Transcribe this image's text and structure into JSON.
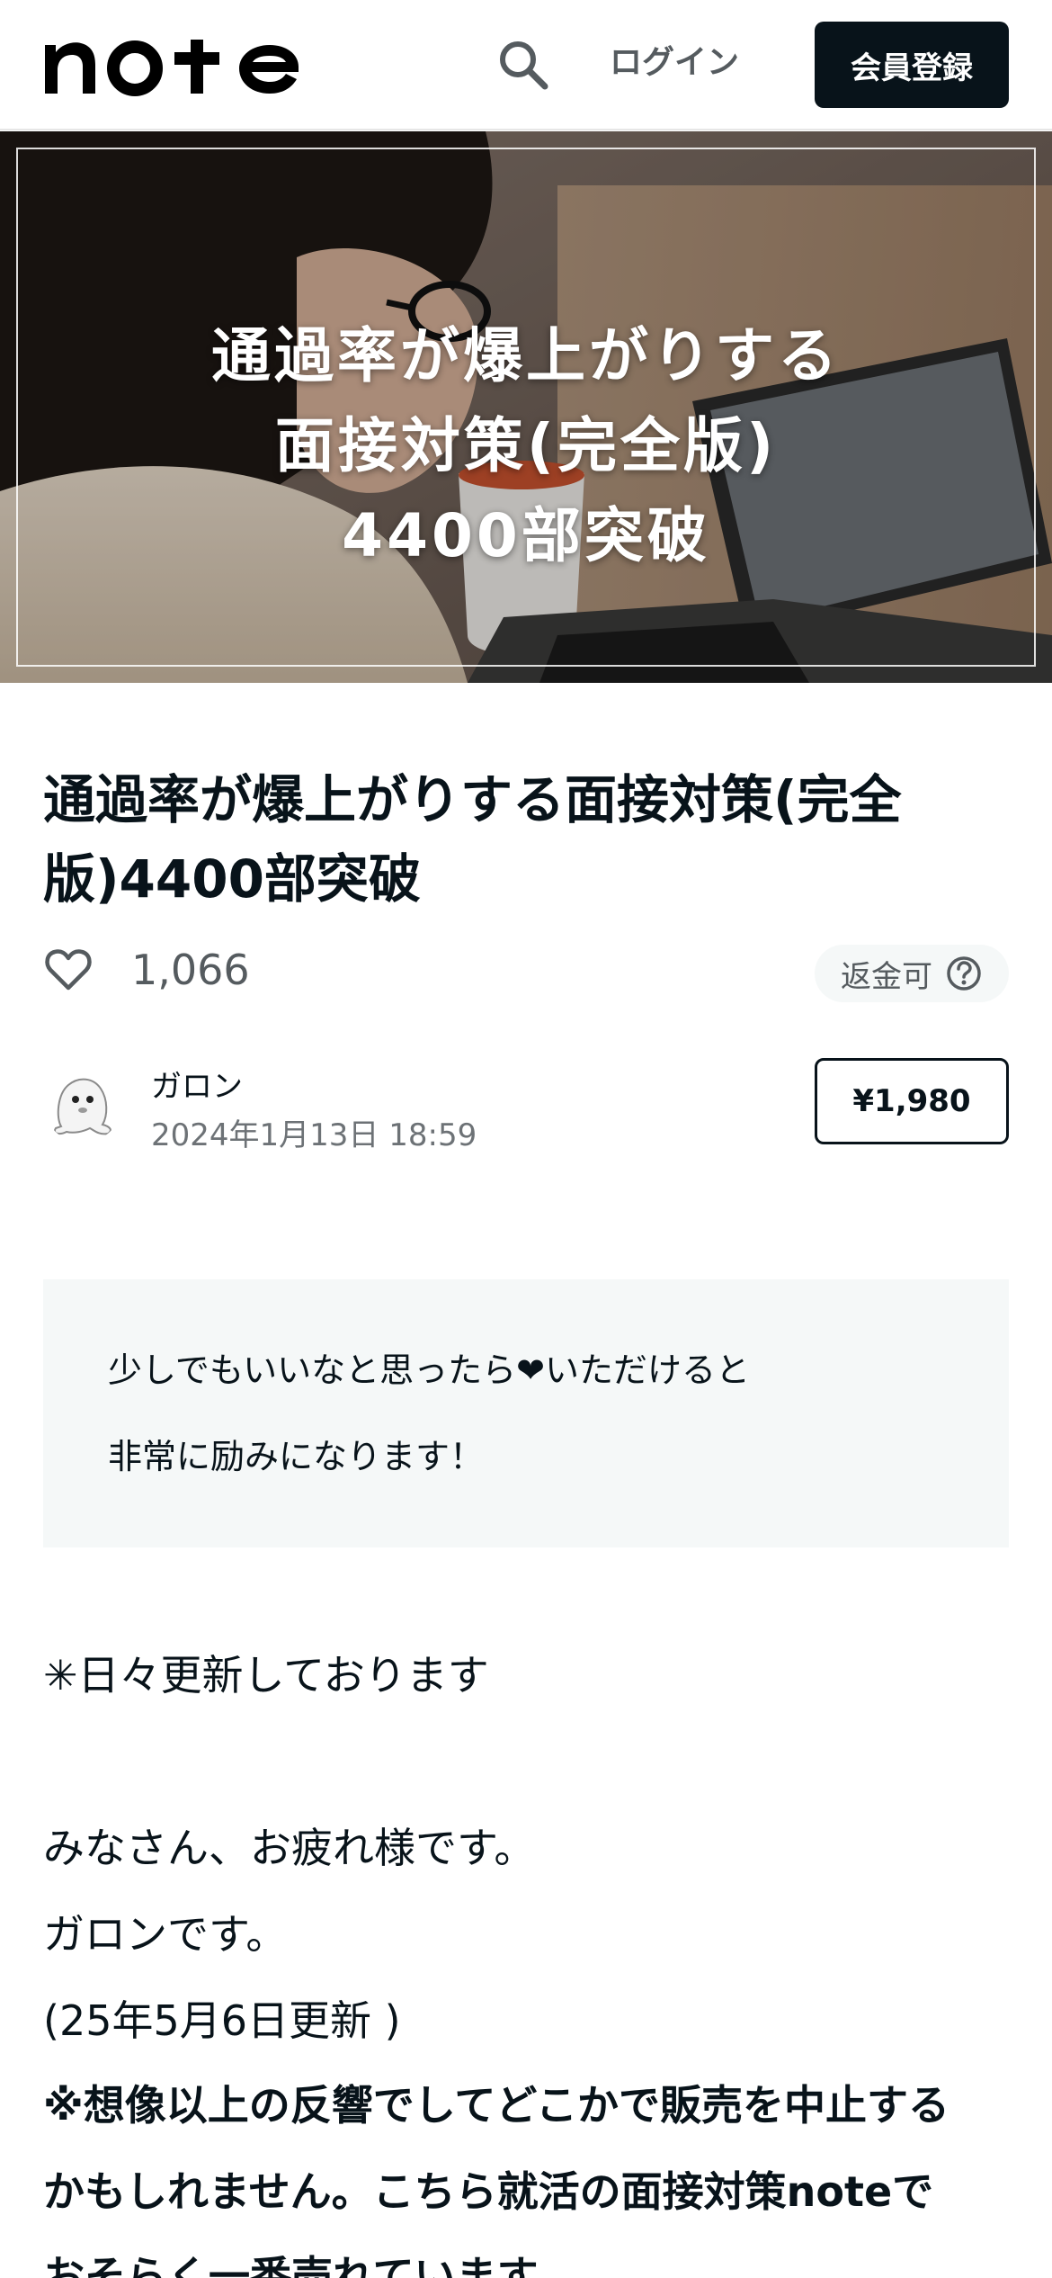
{
  "header": {
    "logo_text": "note",
    "search_icon": "search-icon",
    "login_label": "ログイン",
    "signup_label": "会員登録"
  },
  "hero": {
    "title_lines": [
      "通過率が爆上がりする",
      "面接対策(完全版)",
      "4400部突破"
    ]
  },
  "article": {
    "title": "通過率が爆上がりする面接対策(完全版)4400部突破",
    "like_count": "1,066",
    "refund_label": "返金可",
    "author_name": "ガロン",
    "published_at": "2024年1月13日 18:59",
    "price_label": "¥1,980"
  },
  "callout": {
    "line1": "少しでもいいなと思ったら❤いただけると",
    "line2": "非常に励みになります！"
  },
  "body": {
    "p1": "✳日々更新しております",
    "p2": "みなさん、お疲れ様です。",
    "p3": "ガロンです。",
    "p4": "(25年5月6日更新 )",
    "p5": "※想像以上の反響でしてどこかで販売を中止する",
    "p6": "かもしれません。こちら就活の面接対策noteで",
    "p7": "おそらく一番売れています"
  },
  "colors": {
    "text": "#08131a",
    "muted": "#555b5f",
    "callout_bg": "#f5f8f8",
    "signup_bg": "#08131a"
  }
}
